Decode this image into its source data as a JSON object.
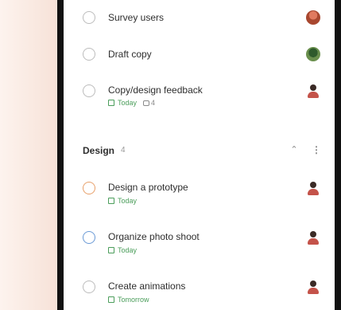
{
  "tasks_top": [
    {
      "title": "Survey users",
      "avatar": "brown"
    },
    {
      "title": "Draft copy",
      "avatar": "green"
    },
    {
      "title": "Copy/design feedback",
      "due": "Today",
      "comments": "4",
      "avatar": "person"
    }
  ],
  "section": {
    "name": "Design",
    "count": "4",
    "collapse_icon": "chevron-up-icon",
    "more_icon": "more-vertical-icon"
  },
  "tasks_design": [
    {
      "title": "Design a prototype",
      "due": "Today",
      "circle_color": "#e8a06a",
      "avatar": "person"
    },
    {
      "title": "Organize photo shoot",
      "due": "Today",
      "circle_color": "#6a9ad6",
      "avatar": "person"
    },
    {
      "title": "Create animations",
      "due": "Tomorrow",
      "circle_color": "#bcbcbc",
      "avatar": "person"
    }
  ]
}
